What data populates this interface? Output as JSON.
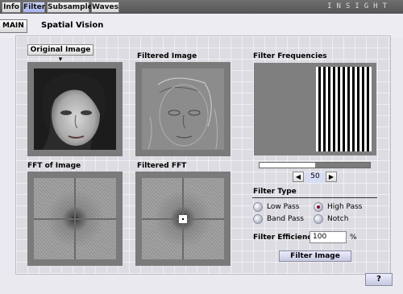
{
  "topbar": {
    "tabs": [
      {
        "label": "Info",
        "active": false
      },
      {
        "label": "Filter",
        "active": true
      },
      {
        "label": "Subsample",
        "active": false
      },
      {
        "label": "Waves",
        "active": false
      }
    ],
    "brand": "INSIGHT"
  },
  "header": {
    "main_label": "MAIN",
    "title": "Spatial Vision"
  },
  "original": {
    "dropdown_label": "Original Image",
    "dropdown_arrow": "▾"
  },
  "filtered_image_label": "Filtered Image",
  "fft_of_image_label": "FFT of Image",
  "filtered_fft_label": "Filtered FFT",
  "frequencies": {
    "label": "Filter Frequencies",
    "slider_fraction": 0.5,
    "value": "50",
    "prev_glyph": "◀",
    "next_glyph": "▶"
  },
  "filter_type": {
    "label": "Filter Type",
    "options": [
      {
        "label": "Low Pass",
        "selected": false
      },
      {
        "label": "High Pass",
        "selected": true
      },
      {
        "label": "Band Pass",
        "selected": false
      },
      {
        "label": "Notch",
        "selected": false
      }
    ]
  },
  "efficiency": {
    "label": "Filter Efficiency:",
    "value": "100",
    "unit": "%"
  },
  "filter_button_label": "Filter Image",
  "help_label": "?",
  "colors": {
    "accent": "#a9b4ee",
    "radio_selected": "#7a1030",
    "panel": "#dcdce2"
  }
}
